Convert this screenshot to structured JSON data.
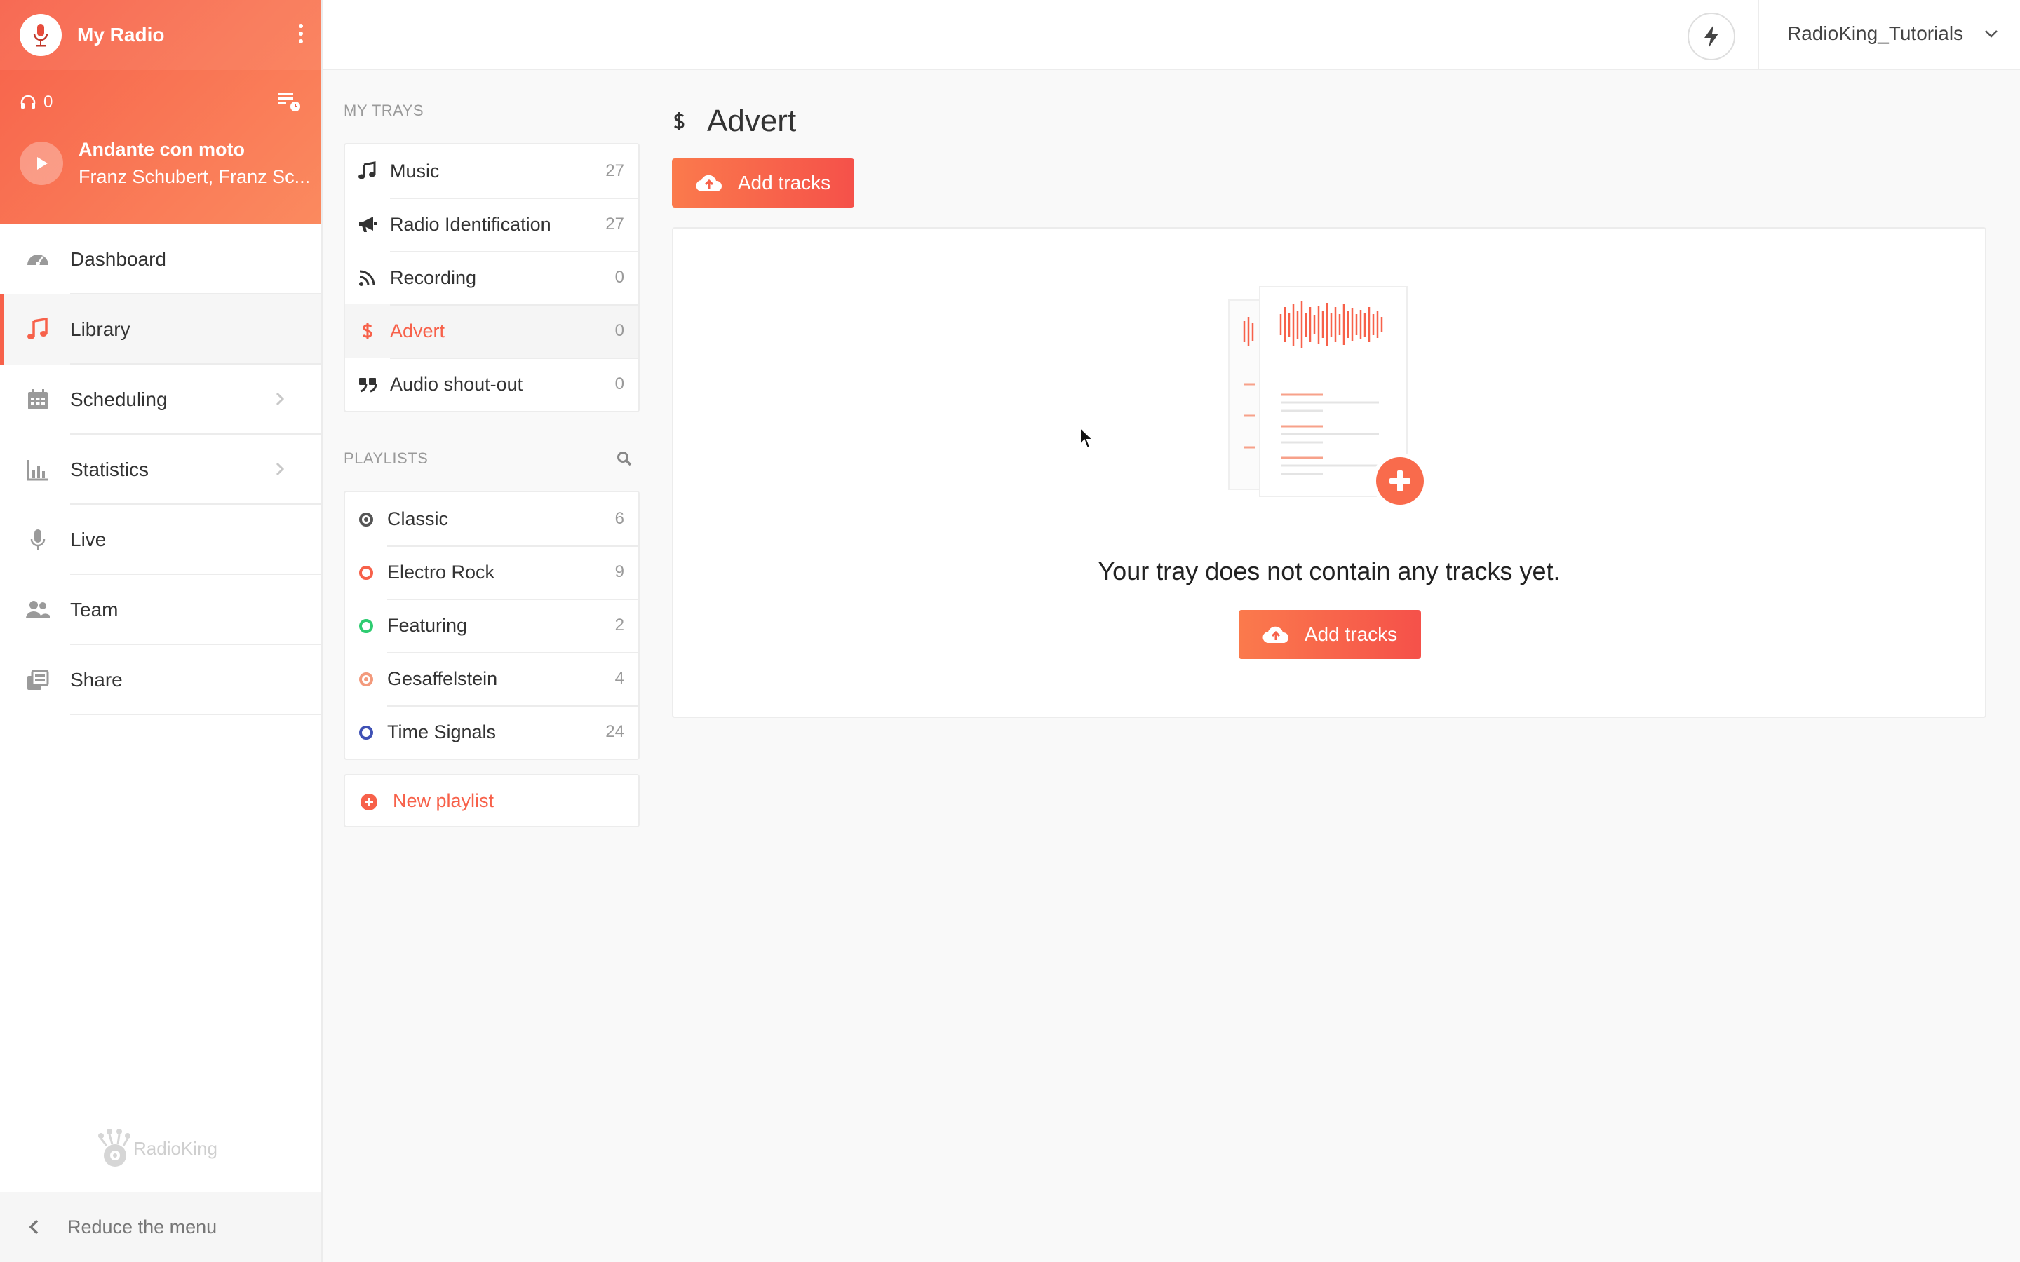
{
  "radio": {
    "name": "My Radio",
    "listeners": "0",
    "now_playing": {
      "title": "Andante con moto",
      "artist": "Franz Schubert, Franz Sc..."
    }
  },
  "nav": [
    {
      "label": "Dashboard",
      "icon": "dashboard-icon"
    },
    {
      "label": "Library",
      "icon": "music-note-icon",
      "active": true
    },
    {
      "label": "Scheduling",
      "icon": "calendar-icon",
      "chevron": true
    },
    {
      "label": "Statistics",
      "icon": "bar-chart-icon",
      "chevron": true
    },
    {
      "label": "Live",
      "icon": "microphone-icon"
    },
    {
      "label": "Team",
      "icon": "users-icon"
    },
    {
      "label": "Share",
      "icon": "share-icon"
    }
  ],
  "brand": {
    "name": "RadioKing"
  },
  "reduce_menu": "Reduce the menu",
  "topbar": {
    "username": "RadioKing_Tutorials"
  },
  "trays": {
    "label": "My trays",
    "items": [
      {
        "label": "Music",
        "count": "27",
        "icon": "music-icon"
      },
      {
        "label": "Radio Identification",
        "count": "27",
        "icon": "bullhorn-icon"
      },
      {
        "label": "Recording",
        "count": "0",
        "icon": "rss-icon"
      },
      {
        "label": "Advert",
        "count": "0",
        "icon": "dollar-icon",
        "active": true
      },
      {
        "label": "Audio shout-out",
        "count": "0",
        "icon": "quote-icon"
      }
    ]
  },
  "playlists": {
    "label": "Playlists",
    "items": [
      {
        "label": "Classic",
        "count": "6",
        "color": "#555555"
      },
      {
        "label": "Electro Rock",
        "count": "9",
        "color": "#f7614a"
      },
      {
        "label": "Featuring",
        "count": "2",
        "color": "#2ecc71"
      },
      {
        "label": "Gesaffelstein",
        "count": "4",
        "color": "#f39a7c"
      },
      {
        "label": "Time Signals",
        "count": "24",
        "color": "#3f51b5"
      }
    ],
    "new_label": "New playlist"
  },
  "main": {
    "title": "Advert",
    "add_tracks_label": "Add tracks",
    "empty_message": "Your tray does not contain any tracks yet."
  },
  "colors": {
    "accent": "#f7614a",
    "accent_light": "#fb8a5f"
  }
}
